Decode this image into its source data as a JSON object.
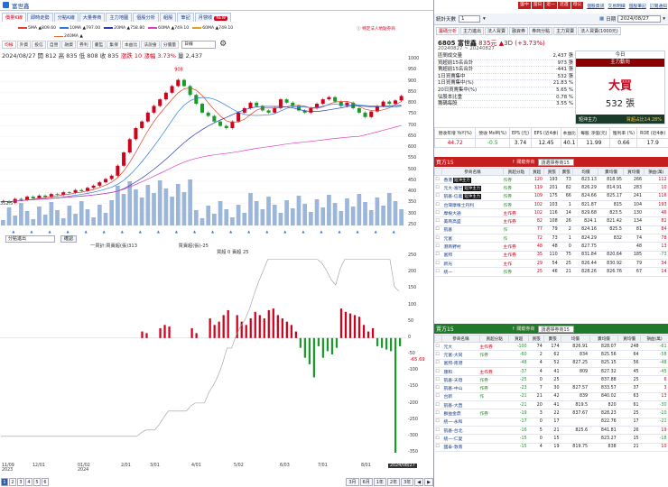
{
  "window": {
    "title": "富世鑫"
  },
  "top_tabs": [
    {
      "label": "價量K線",
      "active": true
    },
    {
      "label": "即時走勢"
    },
    {
      "label": "分點K線"
    },
    {
      "label": "大量券商"
    },
    {
      "label": "主力地圖"
    },
    {
      "label": "個股分析"
    },
    {
      "label": "組股"
    },
    {
      "label": "筆記"
    },
    {
      "label": "月營收",
      "badge": "NEW"
    }
  ],
  "ma_legend": [
    {
      "label": "5MA ▲809.60",
      "color": "#e0442a"
    },
    {
      "label": "10MA ▲797.00",
      "color": "#2a7ce0"
    },
    {
      "label": "20MA ▲758.80",
      "color": "#2a3ab0"
    },
    {
      "label": "60MA ▲749.10",
      "color": "#e040c0"
    },
    {
      "label": "60MA ▲749.10",
      "color": "#e0a020"
    }
  ],
  "ma_legend_second": {
    "label": "240MA ▲",
    "color": "#e07030"
  },
  "notice": "特定法人地點券商",
  "sub_tabs": [
    "均線",
    "外資",
    "投信",
    "自營",
    "融資",
    "券利",
    "董監",
    "集保",
    "本益比",
    "法說會",
    "分價量"
  ],
  "sub_tab_select": "日線",
  "info_line": {
    "date": "2024/08/27",
    "open": "開 812",
    "high": "高 835",
    "low": "低 808",
    "close": "收 835",
    "change": "漲跌 10",
    "pct": "漲幅 3.73%",
    "volume": "量 2,437"
  },
  "peak_label": "908",
  "low_label": "352.5",
  "price_axis": [
    "1000",
    "950",
    "900",
    "850",
    "800",
    "750",
    "700",
    "650",
    "600",
    "550",
    "500",
    "450",
    "400",
    "350",
    "300",
    "250"
  ],
  "indicator": {
    "select": "分點進出",
    "button": "確認",
    "legend_1": "一買計:買賣超(張)313",
    "legend_2": "買超 0  賣超 25",
    "readout": "買賣超(張)-25"
  },
  "sub_axis": [
    "250",
    "200",
    "150",
    "100",
    "50",
    "0",
    "-50",
    "-100",
    "-150",
    "-200",
    "-250",
    "-300",
    "-350"
  ],
  "sub_marker": "-65.69",
  "date_axis": [
    "11/09\n2023",
    "12/01",
    "01/02\n2024",
    "2/01",
    "3/01",
    "4/01",
    "5/02",
    "6/03",
    "7/01",
    "8/01"
  ],
  "date_cursor": "2024/08/27",
  "pages": [
    "1",
    "2",
    "3",
    "4",
    "5",
    "6"
  ],
  "ranges": [
    "3月",
    "6月",
    "1年",
    "2年",
    "3年"
  ],
  "chart_data": {
    "type": "candlestick+volume",
    "x_start": "2023/11/09",
    "x_end": "2024/08/27",
    "y_range": [
      250,
      1000
    ],
    "close_series": [
      360,
      352.5,
      370,
      365,
      380,
      372,
      385,
      378,
      392,
      388,
      400,
      398,
      410,
      405,
      420,
      430,
      445,
      460,
      475,
      520,
      580,
      640,
      690,
      720,
      760,
      790,
      820,
      850,
      880,
      908,
      880,
      840,
      800,
      760,
      745,
      720,
      700,
      690,
      720,
      760,
      780,
      805,
      790,
      770,
      760,
      780,
      820,
      805,
      790,
      770,
      760,
      780,
      800,
      820,
      830,
      810,
      790,
      805,
      780,
      760,
      740,
      765,
      790,
      810,
      800,
      815,
      835
    ],
    "ma_series": [
      {
        "name": "5MA",
        "color": "#e0442a"
      },
      {
        "name": "10MA",
        "color": "#2a7ce0"
      },
      {
        "name": "20MA",
        "color": "#2a3ab0"
      },
      {
        "name": "60MA",
        "color": "#e040c0"
      }
    ],
    "sub_type": "bar",
    "sub_values": [
      0,
      0,
      0,
      0,
      0,
      0,
      0,
      0,
      0,
      0,
      0,
      0,
      0,
      0,
      0,
      0,
      0,
      0,
      0,
      0,
      0,
      0,
      0,
      0,
      0,
      0,
      0,
      0,
      0,
      0,
      0,
      20,
      15,
      0,
      0,
      30,
      40,
      35,
      0,
      0,
      0,
      0,
      30,
      15,
      0,
      0,
      60,
      40,
      50,
      70,
      85,
      0,
      70,
      50,
      40,
      60,
      80,
      70,
      60,
      85,
      90,
      70,
      60,
      50,
      40,
      20,
      -30,
      -60,
      -80,
      -120,
      -25,
      -60,
      -40,
      -50,
      -30,
      90,
      80,
      75,
      70,
      65,
      40,
      20,
      30,
      -25,
      -30,
      -35,
      -40,
      -350,
      -25
    ]
  },
  "right": {
    "topbar": {
      "buttons": [
        "盤中",
        "當日",
        "近一",
        "近週",
        "母公"
      ],
      "links": [
        "個股資訊",
        "交易明細",
        "個股筆記",
        "訂閱通知"
      ]
    },
    "header": {
      "label": "統計天數",
      "days": "1",
      "date_label": "日期",
      "date": "2024/08/27"
    },
    "tabs": [
      "籌碼分析",
      "主力進出",
      "法人買賣",
      "融資券",
      "券商分點",
      "主力買賣",
      "法人買賣(1000元)"
    ],
    "stock": {
      "code_name": "6805 富世鑫",
      "price": "835元",
      "change": "▲3D (+3.73%)",
      "period": "20240827 ~ 20240827"
    },
    "stats": [
      {
        "k": "區間成交量",
        "v": "2,437 張"
      },
      {
        "k": "買超前15名合計",
        "v": "973 張"
      },
      {
        "k": "賣超前15名合計",
        "v": "-441 張"
      },
      {
        "k": "1日買賣集中",
        "v": "532 張"
      },
      {
        "k": "1日買賣集中(%)",
        "v": "21.83 %"
      },
      {
        "k": "20日買賣集中(%)",
        "v": "5.65 %"
      },
      {
        "k": "佔股本比重",
        "v": "0.78 %"
      },
      {
        "k": "籌碼每股",
        "v": "3.55 %"
      }
    ],
    "trend": {
      "head": "今日",
      "sub": "主力動向",
      "signal": "大買",
      "amount": "532 張",
      "foot_l": "短沖主力",
      "foot_r": "買超占比14.28%"
    },
    "fund": {
      "heads": [
        "營收年增 YoY(%)",
        "營收 MoM(%)",
        "EPS (元)",
        "EPS (近4季)",
        "本益比",
        "每股 淨值(元)",
        "殖利率 (%)",
        "ROE (近4季)"
      ],
      "vals": [
        "44.72",
        "-0.5",
        "3.74",
        "12.45",
        "40.1",
        "11.99",
        "0.66",
        "17.9"
      ]
    },
    "buy_head": {
      "title": "買方15",
      "hint": "↑ 關鍵券商",
      "input": "請選擇券商15"
    },
    "cols": [
      "參商名稱",
      "買超分點",
      "買超",
      "買張",
      "賣張",
      "均價",
      "賣均價",
      "買均價",
      "損益(萬)"
    ],
    "buy_rows": [
      [
        "香港",
        "作券",
        "120",
        "193",
        "73",
        "823.13",
        "818.95",
        "266",
        "112"
      ],
      [
        "元大-富世",
        "作券",
        "119",
        "201",
        "82",
        "826.29",
        "814.91",
        "283",
        "10"
      ],
      [
        "凱基-信義",
        "作券",
        "109",
        "175",
        "66",
        "824.66",
        "825.17",
        "241",
        "116"
      ],
      [
        "台灣摩根士丹利",
        "作券",
        "102",
        "103",
        "1",
        "821.87",
        "815",
        "104",
        "193"
      ],
      [
        "摩根大通",
        "主作券",
        "102",
        "116",
        "14",
        "829.68",
        "823.5",
        "130",
        "46"
      ],
      [
        "美商高盛",
        "主作券",
        "82",
        "108",
        "26",
        "824.1",
        "821.42",
        "134",
        "82"
      ],
      [
        "凱基",
        "作",
        "77",
        "79",
        "2",
        "824.16",
        "825.5",
        "81",
        "84"
      ],
      [
        "元富",
        "作",
        "72",
        "73",
        "1",
        "824.29",
        "832",
        "74",
        "78"
      ],
      [
        "港商野村",
        "主作券",
        "48",
        "48",
        "0",
        "827.75",
        "",
        "48",
        "13"
      ],
      [
        "富邦",
        "主作券",
        "35",
        "110",
        "75",
        "831.84",
        "820.64",
        "185",
        "-73"
      ],
      [
        "新光",
        "主作",
        "29",
        "54",
        "25",
        "826.44",
        "830.92",
        "79",
        "34"
      ],
      [
        "統一",
        "作券",
        "25",
        "46",
        "21",
        "828.26",
        "826.76",
        "67",
        "14"
      ]
    ],
    "sell_head": {
      "title": "賣方15",
      "hint": "↑ 關鍵券商",
      "input": "請選擇券商15"
    },
    "sell_rows": [
      [
        "元大",
        "主作券",
        "-100",
        "74",
        "174",
        "826.91",
        "828.07",
        "248",
        "-61"
      ],
      [
        "元富-大同",
        "作券",
        "-60",
        "2",
        "62",
        "834",
        "825.56",
        "64",
        "-58"
      ],
      [
        "富邦-南港",
        "",
        "-48",
        "4",
        "52",
        "827.25",
        "825.15",
        "56",
        "-48"
      ],
      [
        "康和",
        "主作券",
        "-37",
        "4",
        "41",
        "809",
        "827.32",
        "45",
        "-45"
      ],
      [
        "凱基-天母",
        "作券",
        "-25",
        "0",
        "25",
        "",
        "837.88",
        "25",
        "6"
      ],
      [
        "凱基-中山",
        "作券",
        "-23",
        "7",
        "30",
        "827.57",
        "833.57",
        "37",
        "3"
      ],
      [
        "台新",
        "作",
        "-21",
        "21",
        "42",
        "839",
        "840.02",
        "63",
        "13"
      ],
      [
        "凱基-大直",
        "",
        "-21",
        "20",
        "41",
        "819.5",
        "820",
        "61",
        "-30"
      ],
      [
        "群益金鼎",
        "作券",
        "-19",
        "3",
        "22",
        "837.67",
        "828.23",
        "25",
        "-10"
      ],
      [
        "統一-永和",
        "",
        "-17",
        "0",
        "17",
        "",
        "822.76",
        "17",
        "-21"
      ],
      [
        "凱基-台北",
        "",
        "-16",
        "5",
        "21",
        "825.6",
        "841.81",
        "26",
        "19"
      ],
      [
        "統一-仁愛",
        "",
        "-15",
        "0",
        "15",
        "",
        "823.27",
        "15",
        "-18"
      ],
      [
        "國泰-敦南",
        "",
        "-15",
        "4",
        "19",
        "819.75",
        "838",
        "21",
        "10"
      ]
    ],
    "tags": {
      "r0": "短沖主力",
      "r1": "短沖主力",
      "r2": "短沖主力"
    }
  }
}
